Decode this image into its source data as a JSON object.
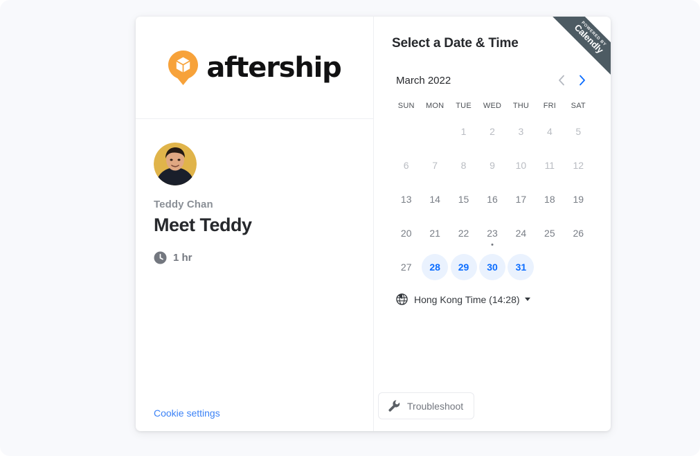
{
  "brand": {
    "logo_icon": "aftership-pin-box-logo",
    "wordmark": "aftership",
    "logo_color": "#f7a23a"
  },
  "left_panel": {
    "avatar_alt": "avatar",
    "host_name": "Teddy Chan",
    "event_title": "Meet Teddy",
    "duration_icon": "clock-icon",
    "duration": "1 hr",
    "cookie_settings": "Cookie settings",
    "cookie_link_color": "#3b82f6"
  },
  "ribbon": {
    "powered_by": "POWERED BY",
    "brand": "Calendly",
    "color": "#4d5b63"
  },
  "scheduler": {
    "heading": "Select a Date & Time",
    "month_label": "March 2022",
    "prev_label": "Previous month",
    "next_label": "Next month",
    "prev_icon": "chevron-left-icon",
    "next_icon": "chevron-right-icon",
    "prev_enabled": false,
    "next_enabled": true,
    "weekdays": [
      "SUN",
      "MON",
      "TUE",
      "WED",
      "THU",
      "FRI",
      "SAT"
    ],
    "accent_color": "#0a6cff",
    "available_bg": "#eaf2fe",
    "weeks": [
      [
        {
          "label": "",
          "state": "empty"
        },
        {
          "label": "",
          "state": "empty"
        },
        {
          "label": "1",
          "state": "disabled"
        },
        {
          "label": "2",
          "state": "disabled"
        },
        {
          "label": "3",
          "state": "disabled"
        },
        {
          "label": "4",
          "state": "disabled"
        },
        {
          "label": "5",
          "state": "disabled"
        }
      ],
      [
        {
          "label": "6",
          "state": "disabled"
        },
        {
          "label": "7",
          "state": "disabled"
        },
        {
          "label": "8",
          "state": "disabled"
        },
        {
          "label": "9",
          "state": "disabled"
        },
        {
          "label": "10",
          "state": "disabled"
        },
        {
          "label": "11",
          "state": "disabled"
        },
        {
          "label": "12",
          "state": "disabled"
        }
      ],
      [
        {
          "label": "13",
          "state": "plain"
        },
        {
          "label": "14",
          "state": "plain"
        },
        {
          "label": "15",
          "state": "plain"
        },
        {
          "label": "16",
          "state": "plain"
        },
        {
          "label": "17",
          "state": "plain"
        },
        {
          "label": "18",
          "state": "plain"
        },
        {
          "label": "19",
          "state": "plain"
        }
      ],
      [
        {
          "label": "20",
          "state": "plain"
        },
        {
          "label": "21",
          "state": "plain"
        },
        {
          "label": "22",
          "state": "plain"
        },
        {
          "label": "23",
          "state": "plain",
          "today": true
        },
        {
          "label": "24",
          "state": "plain"
        },
        {
          "label": "25",
          "state": "plain"
        },
        {
          "label": "26",
          "state": "plain"
        }
      ],
      [
        {
          "label": "27",
          "state": "plain"
        },
        {
          "label": "28",
          "state": "available"
        },
        {
          "label": "29",
          "state": "available"
        },
        {
          "label": "30",
          "state": "available"
        },
        {
          "label": "31",
          "state": "available"
        },
        {
          "label": "",
          "state": "empty"
        },
        {
          "label": "",
          "state": "empty"
        }
      ]
    ],
    "timezone_icon": "globe-icon",
    "timezone_label": "Hong Kong Time (14:28)",
    "troubleshoot_icon": "wrench-icon",
    "troubleshoot_label": "Troubleshoot"
  }
}
